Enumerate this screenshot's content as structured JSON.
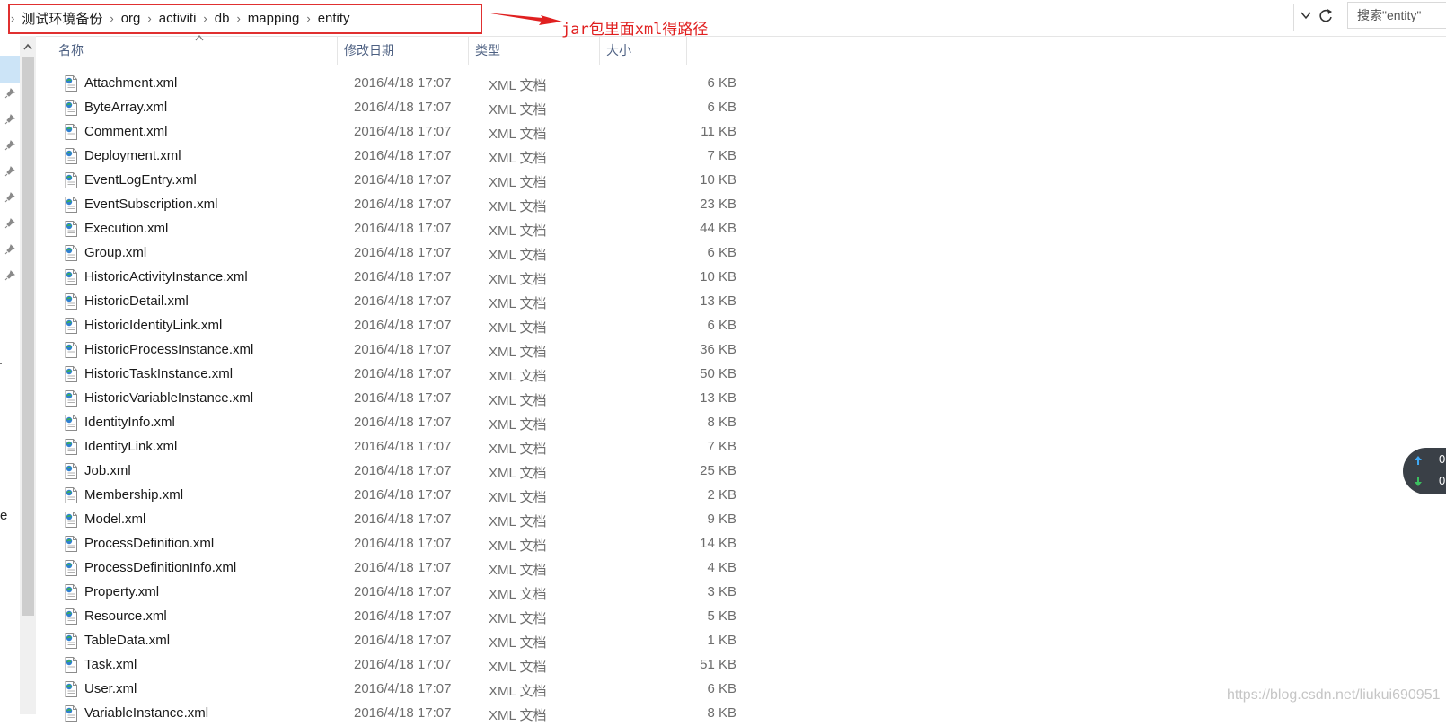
{
  "breadcrumb": {
    "items": [
      "测试环境备份",
      "org",
      "activiti",
      "db",
      "mapping",
      "entity"
    ]
  },
  "annotation": {
    "text": "jar包里面xml得路径",
    "color": "#e02020"
  },
  "search": {
    "placeholder": "搜索\"entity\""
  },
  "columns": {
    "name": "名称",
    "date": "修改日期",
    "type": "类型",
    "size": "大小"
  },
  "files": [
    {
      "name": "Attachment.xml",
      "date": "2016/4/18 17:07",
      "type": "XML 文档",
      "size": "6 KB"
    },
    {
      "name": "ByteArray.xml",
      "date": "2016/4/18 17:07",
      "type": "XML 文档",
      "size": "6 KB"
    },
    {
      "name": "Comment.xml",
      "date": "2016/4/18 17:07",
      "type": "XML 文档",
      "size": "11 KB"
    },
    {
      "name": "Deployment.xml",
      "date": "2016/4/18 17:07",
      "type": "XML 文档",
      "size": "7 KB"
    },
    {
      "name": "EventLogEntry.xml",
      "date": "2016/4/18 17:07",
      "type": "XML 文档",
      "size": "10 KB"
    },
    {
      "name": "EventSubscription.xml",
      "date": "2016/4/18 17:07",
      "type": "XML 文档",
      "size": "23 KB"
    },
    {
      "name": "Execution.xml",
      "date": "2016/4/18 17:07",
      "type": "XML 文档",
      "size": "44 KB"
    },
    {
      "name": "Group.xml",
      "date": "2016/4/18 17:07",
      "type": "XML 文档",
      "size": "6 KB"
    },
    {
      "name": "HistoricActivityInstance.xml",
      "date": "2016/4/18 17:07",
      "type": "XML 文档",
      "size": "10 KB"
    },
    {
      "name": "HistoricDetail.xml",
      "date": "2016/4/18 17:07",
      "type": "XML 文档",
      "size": "13 KB"
    },
    {
      "name": "HistoricIdentityLink.xml",
      "date": "2016/4/18 17:07",
      "type": "XML 文档",
      "size": "6 KB"
    },
    {
      "name": "HistoricProcessInstance.xml",
      "date": "2016/4/18 17:07",
      "type": "XML 文档",
      "size": "36 KB"
    },
    {
      "name": "HistoricTaskInstance.xml",
      "date": "2016/4/18 17:07",
      "type": "XML 文档",
      "size": "50 KB"
    },
    {
      "name": "HistoricVariableInstance.xml",
      "date": "2016/4/18 17:07",
      "type": "XML 文档",
      "size": "13 KB"
    },
    {
      "name": "IdentityInfo.xml",
      "date": "2016/4/18 17:07",
      "type": "XML 文档",
      "size": "8 KB"
    },
    {
      "name": "IdentityLink.xml",
      "date": "2016/4/18 17:07",
      "type": "XML 文档",
      "size": "7 KB"
    },
    {
      "name": "Job.xml",
      "date": "2016/4/18 17:07",
      "type": "XML 文档",
      "size": "25 KB"
    },
    {
      "name": "Membership.xml",
      "date": "2016/4/18 17:07",
      "type": "XML 文档",
      "size": "2 KB"
    },
    {
      "name": "Model.xml",
      "date": "2016/4/18 17:07",
      "type": "XML 文档",
      "size": "9 KB"
    },
    {
      "name": "ProcessDefinition.xml",
      "date": "2016/4/18 17:07",
      "type": "XML 文档",
      "size": "14 KB"
    },
    {
      "name": "ProcessDefinitionInfo.xml",
      "date": "2016/4/18 17:07",
      "type": "XML 文档",
      "size": "4 KB"
    },
    {
      "name": "Property.xml",
      "date": "2016/4/18 17:07",
      "type": "XML 文档",
      "size": "3 KB"
    },
    {
      "name": "Resource.xml",
      "date": "2016/4/18 17:07",
      "type": "XML 文档",
      "size": "5 KB"
    },
    {
      "name": "TableData.xml",
      "date": "2016/4/18 17:07",
      "type": "XML 文档",
      "size": "1 KB"
    },
    {
      "name": "Task.xml",
      "date": "2016/4/18 17:07",
      "type": "XML 文档",
      "size": "51 KB"
    },
    {
      "name": "User.xml",
      "date": "2016/4/18 17:07",
      "type": "XML 文档",
      "size": "6 KB"
    },
    {
      "name": "VariableInstance.xml",
      "date": "2016/4/18 17:07",
      "type": "XML 文档",
      "size": "8 KB"
    }
  ],
  "net_widget": {
    "up": "0",
    "down": "0"
  },
  "left_pane": {
    "partial_label": "e"
  },
  "watermark": "https://blog.csdn.net/liukui690951",
  "icons": {
    "file": "xml-file-icon",
    "pin": "pin-icon",
    "refresh": "refresh-icon",
    "dropdown": "chevron-down-icon",
    "arrow": "red-arrow"
  }
}
